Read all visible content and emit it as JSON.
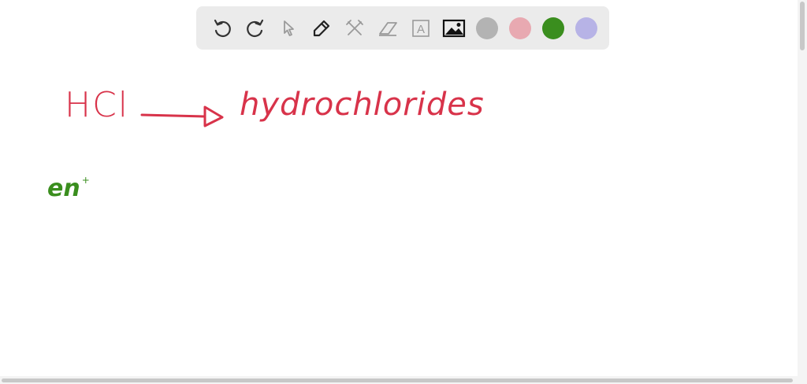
{
  "toolbar": {
    "tools": [
      "undo-icon",
      "redo-icon",
      "pointer-icon",
      "pen-icon",
      "tools-icon",
      "eraser-icon",
      "text-icon",
      "image-icon"
    ],
    "text_tool_label": "A",
    "colors": [
      "#b3b3b3",
      "#e8a9b1",
      "#3a8e1e",
      "#b7b3e6"
    ]
  },
  "canvas": {
    "ink_red": "#d8334a",
    "ink_green": "#3a8e1e",
    "formula": "HCl",
    "product": "hydrochlorides",
    "ion": "en",
    "ion_charge": "+"
  }
}
